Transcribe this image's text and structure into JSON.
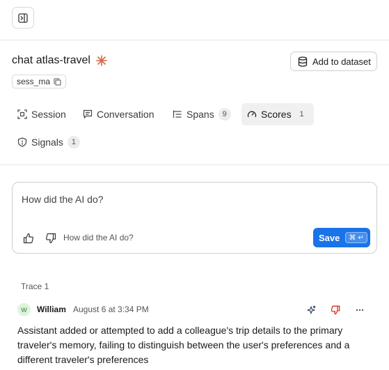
{
  "header": {
    "title": "chat atlas-travel",
    "session_id": "sess_ma",
    "add_to_dataset_label": "Add to dataset"
  },
  "tabs": [
    {
      "label": "Session",
      "icon": "scan-icon",
      "count": null,
      "active": false
    },
    {
      "label": "Conversation",
      "icon": "chat-bubble-icon",
      "count": null,
      "active": false
    },
    {
      "label": "Spans",
      "icon": "list-tree-icon",
      "count": "9",
      "active": false
    },
    {
      "label": "Scores",
      "icon": "gauge-icon",
      "count": "1",
      "active": true
    },
    {
      "label": "Signals",
      "icon": "shield-icon",
      "count": "1",
      "active": false
    }
  ],
  "score_form": {
    "prompt": "How did the AI do?",
    "comment_hint": "How did the AI do?",
    "save_label": "Save",
    "shortcut": "⌘ ↵"
  },
  "trace": {
    "label": "Trace 1",
    "avatar_initial": "W",
    "author": "William",
    "timestamp": "August 6 at 3:34 PM",
    "comment": "Assistant added or attempted to add a colleague's trip details to the primary traveler's memory, failing to distinguish between the user's preferences and a different traveler's preferences",
    "rating": "thumbs-down"
  },
  "colors": {
    "accent": "#1a73e8",
    "sparkle": "#d9653b",
    "thumbs_down": "#d93025"
  }
}
